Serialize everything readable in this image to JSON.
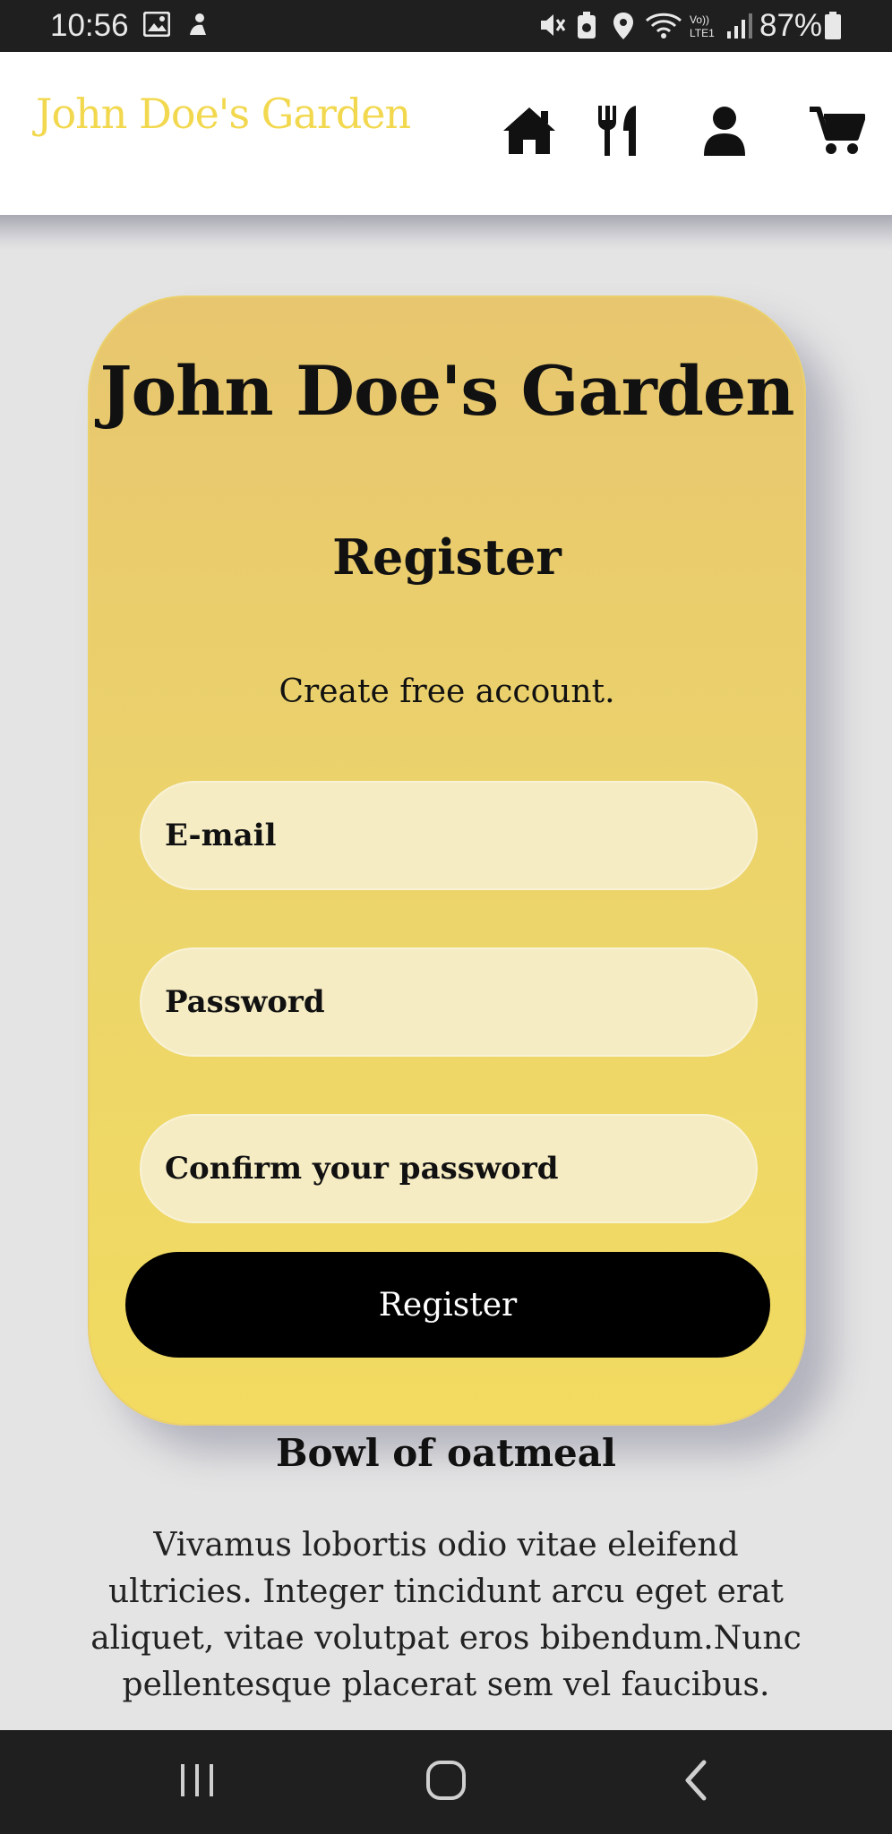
{
  "status_bar": {
    "time": "10:56",
    "battery": "87%",
    "icons": [
      "image-icon",
      "assistant-icon",
      "mute-icon",
      "battery-saver-icon",
      "location-icon",
      "wifi-icon",
      "volte-icon",
      "signal-icon",
      "battery-icon"
    ]
  },
  "header": {
    "brand": "John Doe's Garden",
    "brand_color": "#f2d84e",
    "nav": [
      "home-icon",
      "utensils-icon",
      "user-icon",
      "cart-icon"
    ]
  },
  "register_card": {
    "title": "John Doe's Garden",
    "heading": "Register",
    "subtitle": "Create free account.",
    "email_placeholder": "E-mail",
    "password_placeholder": "Password",
    "confirm_placeholder": "Confirm your password",
    "submit_label": "Register",
    "gradient_top": "#e8c66f",
    "gradient_bottom": "#f2db60"
  },
  "content": {
    "item_title": "Bowl of oatmeal",
    "item_description": "Vivamus lobortis odio vitae eleifend ultricies. Integer tincidunt arcu eget erat aliquet, vitae volutpat eros bibendum.Nunc pellentesque placerat sem vel faucibus."
  },
  "system_nav": [
    "recents-icon",
    "home-circle-icon",
    "back-icon"
  ]
}
